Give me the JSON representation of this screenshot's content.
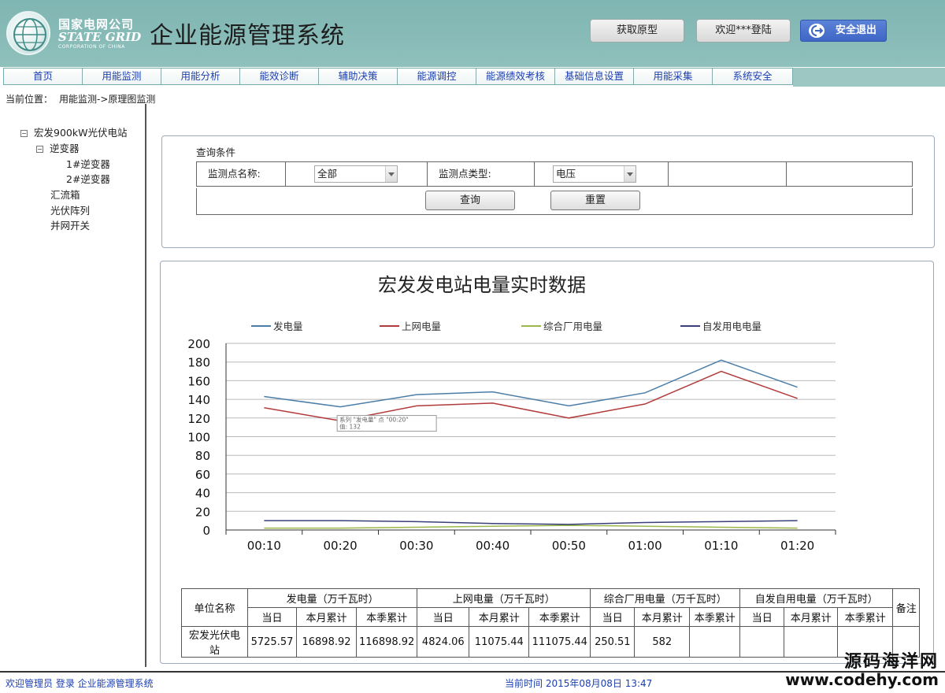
{
  "header": {
    "logo_cn": "国家电网公司",
    "logo_en": "STATE GRID",
    "logo_sub": "CORPORATION OF CHINA",
    "app_title": "企业能源管理系统",
    "btn_prototype": "获取原型",
    "btn_welcome": "欢迎***登陆",
    "btn_logout": "安全退出"
  },
  "nav": {
    "items": [
      "首页",
      "用能监测",
      "用能分析",
      "能效诊断",
      "辅助决策",
      "能源调控",
      "能源绩效考核",
      "基础信息设置",
      "用能采集",
      "系统安全"
    ]
  },
  "breadcrumb": {
    "label": "当前位置：",
    "path": "用能监测->原理图监测"
  },
  "tree": {
    "root": "宏发900kW光伏电站",
    "inverter": "逆变器",
    "inverter1": "1#逆变器",
    "inverter2": "2#逆变器",
    "combiner": "汇流箱",
    "array": "光伏阵列",
    "grid_switch": "并网开关"
  },
  "query": {
    "legend": "查询条件",
    "point_name_label": "监测点名称:",
    "point_name_value": "全部",
    "point_type_label": "监测点类型:",
    "point_type_value": "电压",
    "search_button": "查询",
    "reset_button": "重置"
  },
  "chart_data": {
    "type": "line",
    "title": "宏发发电站电量实时数据",
    "categories": [
      "00:10",
      "00:20",
      "00:30",
      "00:40",
      "00:50",
      "01:00",
      "01:10",
      "01:20"
    ],
    "ylim": [
      0,
      200
    ],
    "yticks": [
      0,
      20,
      40,
      60,
      80,
      100,
      120,
      140,
      160,
      180,
      200
    ],
    "grid": true,
    "legend_position": "top",
    "series": [
      {
        "name": "发电量",
        "color": "#4a7ea8",
        "values": [
          143,
          132,
          145,
          148,
          133,
          147,
          182,
          153
        ]
      },
      {
        "name": "上网电量",
        "color": "#b23a3a",
        "values": [
          131,
          117,
          133,
          136,
          120,
          135,
          170,
          141
        ]
      },
      {
        "name": "综合厂用电量",
        "color": "#9ab84a",
        "values": [
          2,
          2,
          3,
          4,
          5,
          4,
          3,
          2
        ]
      },
      {
        "name": "自发用电电量",
        "color": "#3a3f7a",
        "values": [
          10,
          10,
          9,
          7,
          6,
          8,
          9,
          10
        ]
      }
    ],
    "tooltip": {
      "line1": "系列 \"发电量\" 点 \"00:20\"",
      "line2": "值: 132"
    }
  },
  "table": {
    "unit_header": "单位名称",
    "groups": [
      "发电量（万千瓦时）",
      "上网电量（万千瓦时）",
      "综合厂用电量（万千瓦时）",
      "自发自用电量（万千瓦时）"
    ],
    "remark_header": "备注",
    "sub_headers": [
      "当日",
      "本月累计",
      "本季累计"
    ],
    "row": {
      "name": "宏发光伏电站",
      "values": [
        "5725.57",
        "16898.92",
        "116898.92",
        "4824.06",
        "11075.44",
        "111075.44",
        "250.51",
        "582"
      ]
    }
  },
  "footer": {
    "left": "欢迎管理员 登录 企业能源管理系统",
    "time": "当前时间 2015年08月08日 13:47"
  },
  "watermark": {
    "line1": "源码海洋网",
    "line2": "www.codehy.com"
  }
}
